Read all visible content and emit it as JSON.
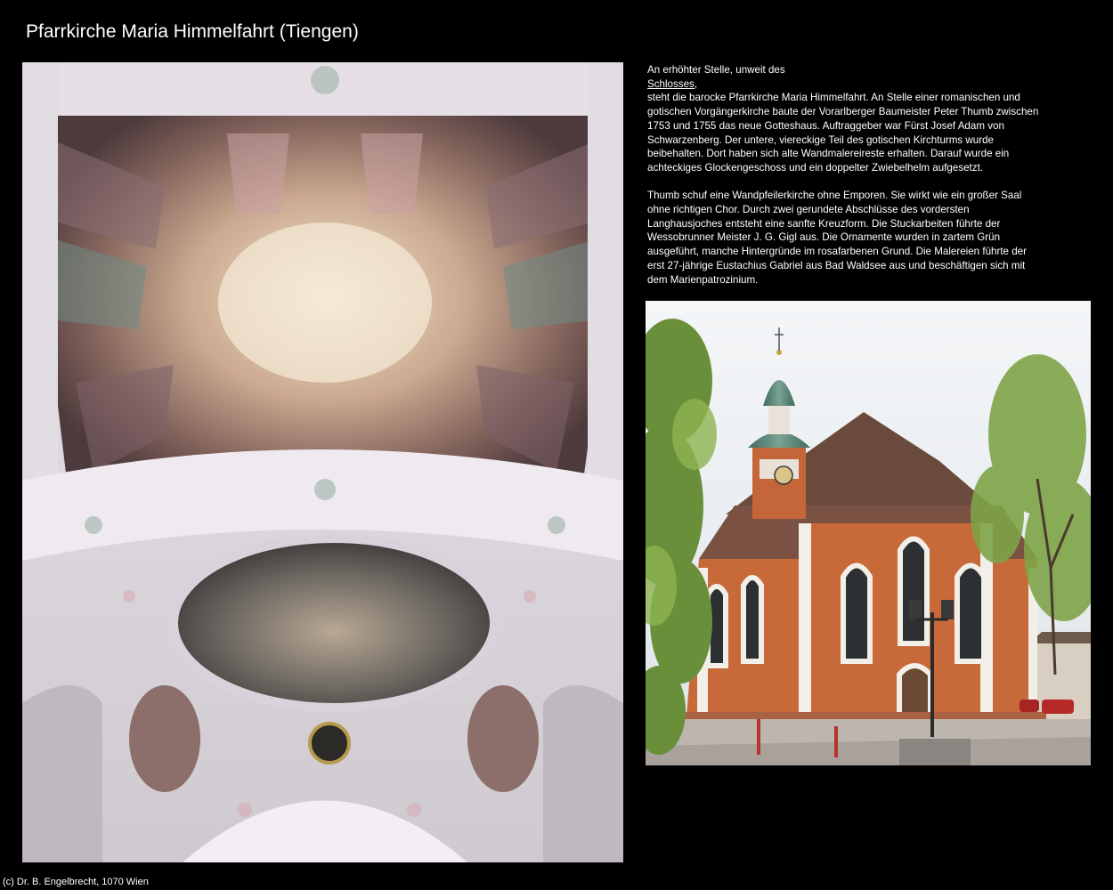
{
  "page": {
    "title": "Pfarrkirche Maria Himmelfahrt (Tiengen)",
    "footer": "(c) Dr. B. Engelbrecht, 1070 Wien"
  },
  "images": {
    "left": {
      "subject": "baroque ceiling fresco with white stucco ornaments"
    },
    "right": {
      "subject": "church exterior with onion-dome tower, orange and white facade, lanterns"
    }
  },
  "text": {
    "intro": "An erhöhter Stelle, unweit des",
    "link_label": "Schlosses,",
    "p1_lines": [
      "steht die barocke Pfarrkirche Maria Himmelfahrt. An Stelle einer romanischen und",
      "gotischen Vorgängerkirche baute der Vorarlberger Baumeister Peter Thumb zwischen",
      "1753 und 1755 das neue Gotteshaus. Auftraggeber war Fürst Josef Adam von",
      "Schwarzenberg. Der untere, viereckige Teil des gotischen Kirchturms wurde",
      "beibehalten. Dort haben sich alte Wandmalereireste erhalten. Darauf wurde ein",
      "achteckiges Glockengeschoss und ein doppelter Zwiebelhelm aufgesetzt."
    ],
    "p2_lines": [
      "Thumb schuf eine Wandpfeilerkirche ohne Emporen. Sie wirkt wie ein großer Saal",
      "ohne richtigen Chor. Durch zwei gerundete Abschlüsse des vordersten",
      "Langhausjoches entsteht eine sanfte Kreuzform. Die Stuckarbeiten führte der",
      "Wessobrunner Meister J. G. Gigl aus. Die Ornamente wurden in zartem Grün",
      "ausgeführt, manche Hintergründe im rosafarbenen Grund. Die Malereien führte der",
      "erst 27-jährige Eustachius Gabriel aus Bad Waldsee aus und beschäftigen sich mit",
      "dem Marienpatrozinium."
    ]
  },
  "colors": {
    "background": "#000000",
    "text": "#ffffff",
    "facade_orange": "#c8693a",
    "dome_green": "#5f8a7a",
    "stucco_white": "#e8e4e8"
  }
}
